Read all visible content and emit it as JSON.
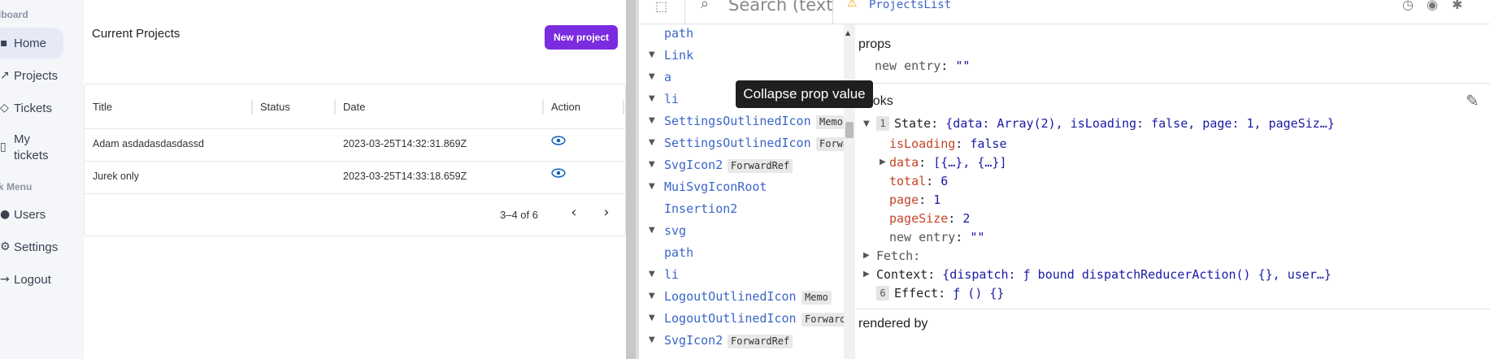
{
  "sidebar": {
    "sections": [
      "iboard",
      "k Menu"
    ],
    "items": [
      {
        "icon": "home-icon",
        "label": "Home",
        "active": true
      },
      {
        "icon": "chart-icon",
        "label": "Projects"
      },
      {
        "icon": "tag-icon",
        "label": "Tickets"
      },
      {
        "icon": "ticket-icon",
        "label": "My tickets"
      },
      {
        "icon": "user-icon",
        "label": "Users"
      },
      {
        "icon": "gear-icon",
        "label": "Settings"
      },
      {
        "icon": "logout-icon",
        "label": "Logout"
      }
    ]
  },
  "projects": {
    "title": "Current Projects",
    "new_button": "New project",
    "columns": [
      "Title",
      "Status",
      "Date",
      "Action"
    ],
    "rows": [
      {
        "title": "Adam asdadasdasdassd",
        "status": "",
        "date": "2023-03-25T14:32:31.869Z",
        "action_icon": "eye-icon"
      },
      {
        "title": "Jurek only",
        "status": "",
        "date": "2023-03-25T14:33:18.659Z",
        "action_icon": "eye-icon"
      }
    ],
    "pagination": {
      "range": "3–4 of 6"
    }
  },
  "devtools": {
    "search_placeholder": "Search (text",
    "selected_component": "ProjectsList",
    "tree": [
      {
        "name": "path",
        "arrow": false,
        "badge": ""
      },
      {
        "name": "Link",
        "arrow": true,
        "badge": ""
      },
      {
        "name": "a",
        "arrow": true,
        "badge": ""
      },
      {
        "name": "li",
        "arrow": true,
        "badge": ""
      },
      {
        "name": "SettingsOutlinedIcon",
        "arrow": true,
        "badge": "Memo"
      },
      {
        "name": "SettingsOutlinedIcon",
        "arrow": true,
        "badge": "ForwardRef"
      },
      {
        "name": "SvgIcon2",
        "arrow": true,
        "badge": "ForwardRef"
      },
      {
        "name": "MuiSvgIconRoot",
        "arrow": true,
        "badge": ""
      },
      {
        "name": "Insertion2",
        "arrow": false,
        "badge": ""
      },
      {
        "name": "svg",
        "arrow": true,
        "badge": ""
      },
      {
        "name": "path",
        "arrow": false,
        "badge": ""
      },
      {
        "name": "li",
        "arrow": true,
        "badge": ""
      },
      {
        "name": "LogoutOutlinedIcon",
        "arrow": true,
        "badge": "Memo"
      },
      {
        "name": "LogoutOutlinedIcon",
        "arrow": true,
        "badge": "ForwardRef"
      },
      {
        "name": "SvgIcon2",
        "arrow": true,
        "badge": "ForwardRef"
      }
    ],
    "tooltip": "Collapse prop value",
    "props_title": "props",
    "props": [
      {
        "key": "new entry",
        "value": "\"\""
      }
    ],
    "hooks_title": "hooks",
    "hooks": {
      "state_index": "1",
      "state_label": "State:",
      "state_summary": "{data: Array(2), isLoading: false, page: 1, pageSiz…}",
      "fields": [
        {
          "key": "isLoading",
          "value": "false"
        },
        {
          "key": "data",
          "value": "[{…}, {…}]"
        },
        {
          "key": "total",
          "value": "6"
        },
        {
          "key": "page",
          "value": "1"
        },
        {
          "key": "pageSize",
          "value": "2"
        }
      ],
      "new_entry_key": "new entry",
      "new_entry_value": "\"\"",
      "fetch_label": "Fetch:",
      "context_label": "Context:",
      "context_value": "{dispatch: ƒ bound dispatchReducerAction() {}, user…}",
      "effect_index": "6",
      "effect_label": "Effect:",
      "effect_value": "ƒ () {}"
    },
    "rendered_by": "rendered by"
  },
  "colors": {
    "accent": "#7b2be0",
    "devtools_blue": "#3b65c8",
    "devtools_key_red": "#c8442a"
  }
}
